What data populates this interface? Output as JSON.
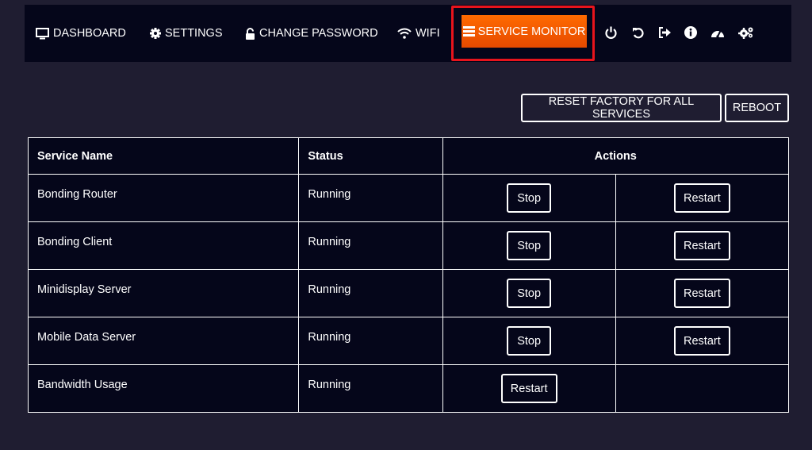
{
  "nav": {
    "dashboard": "DASHBOARD",
    "settings": "SETTINGS",
    "change_password": "CHANGE PASSWORD",
    "wifi": "WIFI",
    "service_monitor": "SERVICE MONITOR",
    "icons": [
      "power-icon",
      "undo-icon",
      "sign-out-icon",
      "info-icon",
      "speedometer-icon",
      "cogs-icon"
    ]
  },
  "toolbar": {
    "reset_factory": "RESET FACTORY FOR ALL SERVICES",
    "reboot": "REBOOT"
  },
  "table": {
    "headers": {
      "name": "Service Name",
      "status": "Status",
      "actions": "Actions"
    },
    "rows": [
      {
        "name": "Bonding Router",
        "status": "Running",
        "stop": "Stop",
        "restart": "Restart"
      },
      {
        "name": "Bonding Client",
        "status": "Running",
        "stop": "Stop",
        "restart": "Restart"
      },
      {
        "name": "Minidisplay Server",
        "status": "Running",
        "stop": "Stop",
        "restart": "Restart"
      },
      {
        "name": "Mobile Data Server",
        "status": "Running",
        "stop": "Stop",
        "restart": "Restart"
      },
      {
        "name": "Bandwidth Usage",
        "status": "Running",
        "restart": "Restart"
      }
    ]
  },
  "colors": {
    "background": "#1f1d31",
    "panel": "#05061a",
    "accent": "#ff6a00",
    "highlight_border": "#e8141c"
  }
}
